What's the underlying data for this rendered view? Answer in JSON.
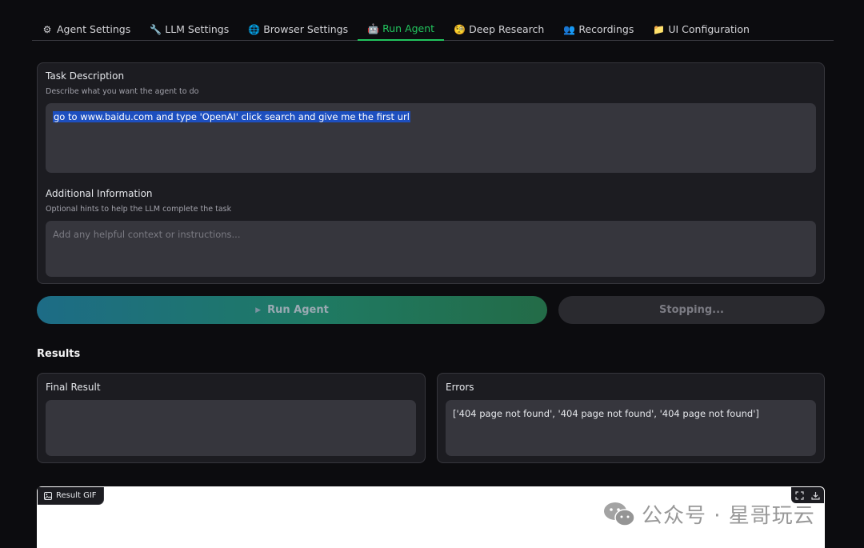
{
  "tabs": [
    {
      "icon": "gear-icon",
      "glyph": "⚙",
      "label": "Agent Settings"
    },
    {
      "icon": "wrench-icon",
      "glyph": "🔧",
      "label": "LLM Settings"
    },
    {
      "icon": "globe-icon",
      "glyph": "🌐",
      "label": "Browser Settings"
    },
    {
      "icon": "robot-icon",
      "glyph": "🤖",
      "label": "Run Agent"
    },
    {
      "icon": "nerd-face-icon",
      "glyph": "🧐",
      "label": "Deep Research"
    },
    {
      "icon": "recordings-icon",
      "glyph": "👥",
      "label": "Recordings"
    },
    {
      "icon": "folder-icon",
      "glyph": "📁",
      "label": "UI Configuration"
    }
  ],
  "active_tab": "Run Agent",
  "task": {
    "label": "Task Description",
    "hint": "Describe what you want the agent to do",
    "value": "go to www.baidu.com and type 'OpenAI' click search and give me the first url"
  },
  "additional": {
    "label": "Additional Information",
    "hint": "Optional hints to help the LLM complete the task",
    "placeholder": "Add any helpful context or instructions..."
  },
  "buttons": {
    "run": "Run Agent",
    "stop": "Stopping..."
  },
  "results": {
    "title": "Results",
    "final_label": "Final Result",
    "final_value": "",
    "errors_label": "Errors",
    "errors_value": "['404 page not found', '404 page not found', '404 page not found']"
  },
  "gif": {
    "label": "Result GIF"
  },
  "watermark": {
    "text": "公众号 · 星哥玩云"
  },
  "colors": {
    "accent": "#22c55e",
    "background": "#0c0c0f",
    "panel": "#1c1c21",
    "field": "#36363d"
  }
}
